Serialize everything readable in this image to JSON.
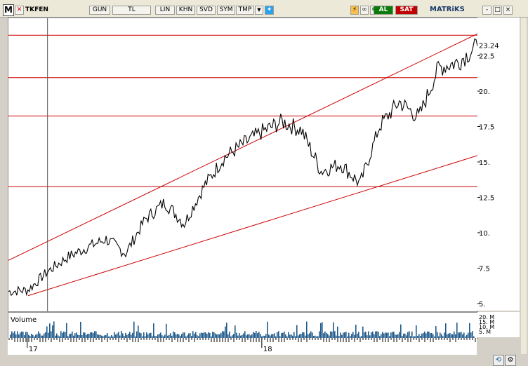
{
  "toolbar": {
    "symbol": "TKFEN",
    "buttons": [
      "GUN",
      "TL",
      "LIN",
      "KHN",
      "SVD",
      "SYM",
      "TMP"
    ],
    "right_icons": [
      "lightning-icon",
      "chain-icon",
      "refresh-icon"
    ],
    "buy_label": "AL",
    "sell_label": "SAT",
    "brand": "MATRiKS",
    "window_buttons": [
      "-",
      "□",
      "×"
    ]
  },
  "colors": {
    "buy": "#0a7a0a",
    "sell": "#c00000",
    "channel": "#cc0000",
    "volume": "#1f5a8a",
    "price": "#000000"
  },
  "chart_data": {
    "type": "line",
    "ylim": [
      4.5,
      25.2
    ],
    "y_ticks": [
      "5.",
      "7.5",
      "10.",
      "12.5",
      "15.",
      "17.5",
      "20.",
      "22.5"
    ],
    "last_value_label": "23.24",
    "x_tick_labels": [
      "17",
      "18"
    ],
    "volume_label": "Volume",
    "volume_ticks": [
      "20. M",
      "15. M",
      "10. M",
      "5. M"
    ],
    "x_start": "2016-12",
    "x_end": "2018-12",
    "series": [
      {
        "x": [
          "2016-12",
          "2017-01",
          "2017-02",
          "2017-03",
          "2017-04",
          "2017-05",
          "2017-06",
          "2017-07",
          "2017-08",
          "2017-09",
          "2017-10",
          "2017-11",
          "2017-12",
          "2018-01",
          "2018-02",
          "2018-03",
          "2018-04",
          "2018-05",
          "2018-06",
          "2018-07",
          "2018-08",
          "2018-09",
          "2018-10",
          "2018-11",
          "2018-12"
        ],
        "values": [
          5.9,
          6.0,
          7.3,
          8.3,
          9.0,
          9.6,
          8.6,
          11.0,
          12.2,
          10.7,
          13.3,
          15.3,
          16.3,
          17.2,
          17.9,
          17.3,
          14.4,
          14.9,
          13.5,
          17.6,
          19.3,
          18.2,
          21.7,
          22.1,
          23.24
        ]
      }
    ],
    "horizontal_lines": [
      24.0,
      21.0,
      18.3,
      13.3
    ],
    "trend_lines": [
      {
        "from": [
          "2016-12",
          8.1
        ],
        "to": [
          "2018-12",
          24.1
        ]
      },
      {
        "from": [
          "2017-01",
          5.6
        ],
        "to": [
          "2018-12",
          15.5
        ]
      }
    ],
    "vertical_marker": "2017-02"
  }
}
